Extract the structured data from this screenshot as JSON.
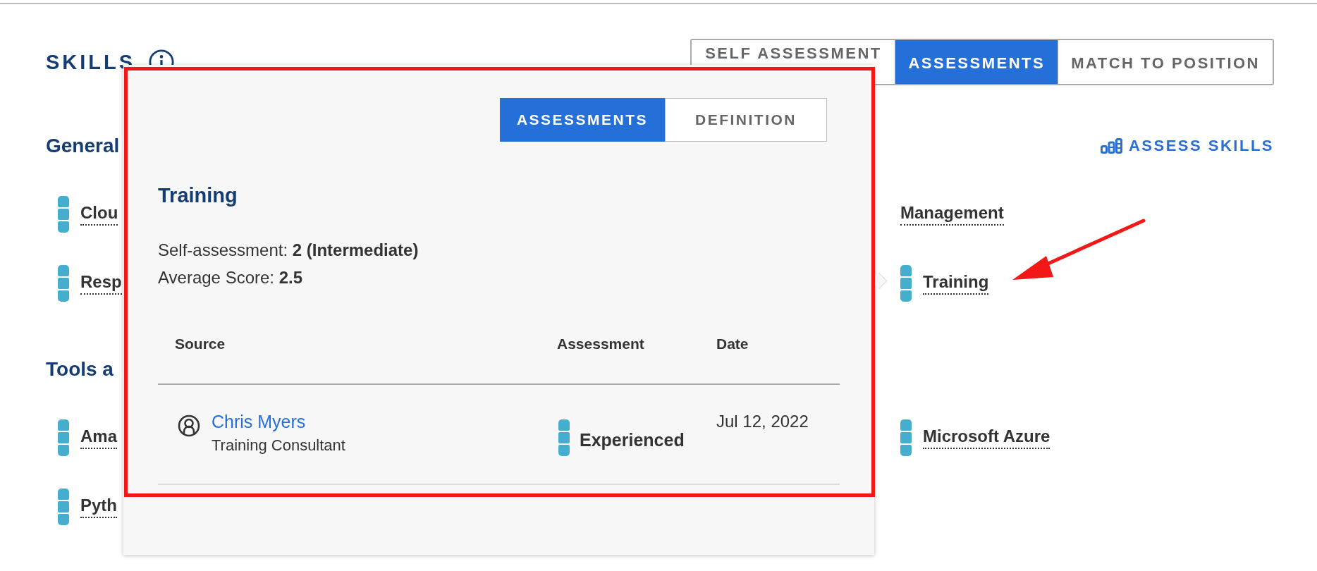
{
  "page_title": "SKILLS",
  "page_tabs": [
    {
      "label": "SELF ASSESSMENT",
      "selected": false
    },
    {
      "label": "ASSESSMENTS",
      "selected": true
    },
    {
      "label": "MATCH TO POSITION",
      "selected": false
    }
  ],
  "assess_link": "ASSESS SKILLS",
  "sections": [
    {
      "title": "General",
      "items": [
        {
          "label": "Clou",
          "assessed": true
        },
        {
          "label": "Management",
          "assessed": false
        },
        {
          "label": "Resp",
          "assessed": true
        },
        {
          "label": "Training",
          "assessed": true
        }
      ]
    },
    {
      "title": "Tools a",
      "items": [
        {
          "label": "Ama",
          "assessed": true
        },
        {
          "label": "Microsoft Azure",
          "assessed": true
        },
        {
          "label": "Pyth",
          "assessed": true
        }
      ]
    }
  ],
  "popup": {
    "tabs": [
      {
        "label": "ASSESSMENTS",
        "selected": true
      },
      {
        "label": "DEFINITION",
        "selected": false
      }
    ],
    "title": "Training",
    "lines": [
      "Self-assessment: **2 (Intermediate)**",
      "Average Score: **2.5**"
    ],
    "columns": [
      "Source",
      "Assessment",
      "Date"
    ],
    "rows": [
      {
        "name": "Chris Myers",
        "role": "Training Consultant",
        "assessment": "Experienced",
        "date": "Jul 12, 2022"
      }
    ]
  }
}
